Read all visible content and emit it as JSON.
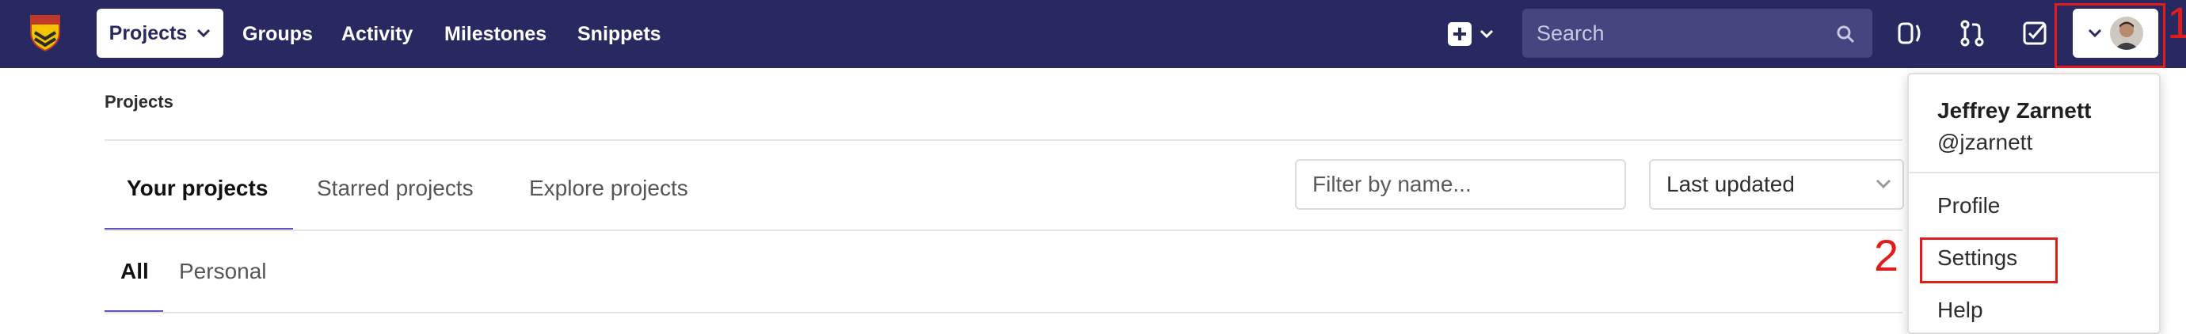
{
  "navbar": {
    "projects_label": "Projects",
    "links": [
      "Groups",
      "Activity",
      "Milestones",
      "Snippets"
    ],
    "search_placeholder": "Search",
    "icons": [
      "new-item-icon",
      "search-icon",
      "issues-icon",
      "merge-requests-icon",
      "todos-icon",
      "user-avatar"
    ]
  },
  "page": {
    "breadcrumb": "Projects",
    "tabs": [
      "Your projects",
      "Starred projects",
      "Explore projects"
    ],
    "subtabs": [
      "All",
      "Personal"
    ],
    "filter_placeholder": "Filter by name...",
    "sort_value": "Last updated"
  },
  "user_menu": {
    "name": "Jeffrey Zarnett",
    "username": "@jzarnett",
    "items": [
      "Profile",
      "Settings",
      "Help"
    ]
  },
  "annotations": [
    "1",
    "2"
  ],
  "colors": {
    "navbar": "#292961",
    "accent": "#6b4fbb",
    "annotation": "#e21b1b"
  }
}
